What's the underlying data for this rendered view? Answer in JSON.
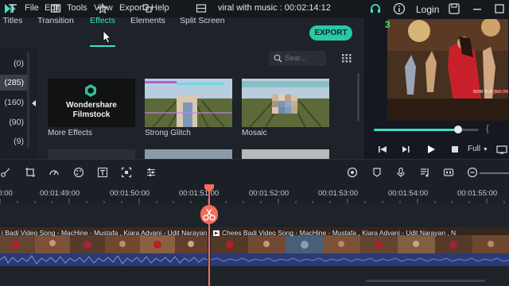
{
  "menu": {
    "items": [
      "File",
      "Edit",
      "Tools",
      "View",
      "Export",
      "Help"
    ],
    "title": "viral with music : 00:02:14:12",
    "login_label": "Login"
  },
  "tabs": [
    {
      "label": "Titles",
      "icon": "titles-icon"
    },
    {
      "label": "Transition",
      "icon": "transition-icon"
    },
    {
      "label": "Effects",
      "icon": "effects-icon",
      "active": true
    },
    {
      "label": "Elements",
      "icon": "elements-icon"
    },
    {
      "label": "Split Screen",
      "icon": "split-screen-icon"
    }
  ],
  "export_label": "EXPORT",
  "categories": [
    "(0)",
    "(285)",
    "(160)",
    "(90)",
    "(9)"
  ],
  "search": {
    "placeholder": "Sear..."
  },
  "effects": [
    {
      "label": "More Effects",
      "logo_line1": "Wondershare",
      "logo_line2": "Filmstock"
    },
    {
      "label": "Strong Glitch"
    },
    {
      "label": "Mosaic"
    }
  ],
  "preview": {
    "marker": "3",
    "progress": 0.8,
    "quality": "Full"
  },
  "timeline": {
    "ticks": [
      "00:00",
      "00:01:49:00",
      "00:01:50:00",
      "00:01:51:00",
      "00:01:52:00",
      "00:01:53:00",
      "00:01:54:00",
      "00:01:55:00"
    ],
    "clip_left_title": "i Badi Video Song - MacHine - Mustafa , Kiara Advani - Udit Narayan , N",
    "clip_right_title": "Chees Badi Video Song - MacHine - Mustafa , Kiara Advani - Udit Narayan , N"
  },
  "colors": {
    "accent": "#3fe0c5",
    "export": "#27c9a6",
    "playhead": "#f26d5b",
    "clip": "#3a4da0"
  }
}
